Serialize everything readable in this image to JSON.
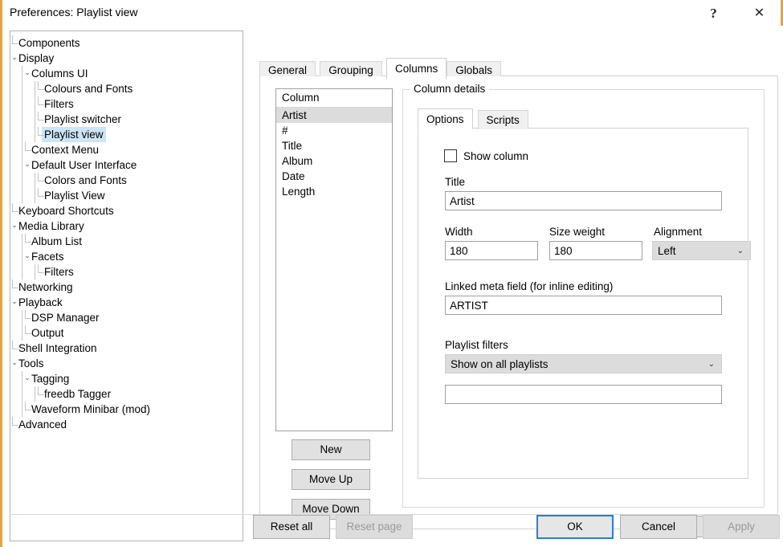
{
  "window": {
    "title": "Preferences: Playlist view",
    "accent_color": "#e8a33d",
    "help_glyph": "?",
    "close_glyph": "✕"
  },
  "tree": {
    "items": [
      {
        "label": "Components",
        "depth": 0,
        "chevron": "",
        "selected": false
      },
      {
        "label": "Display",
        "depth": 0,
        "chevron": "v",
        "selected": false
      },
      {
        "label": "Columns UI",
        "depth": 1,
        "chevron": "v",
        "selected": false
      },
      {
        "label": "Colours and Fonts",
        "depth": 2,
        "chevron": "",
        "selected": false
      },
      {
        "label": "Filters",
        "depth": 2,
        "chevron": "",
        "selected": false
      },
      {
        "label": "Playlist switcher",
        "depth": 2,
        "chevron": "",
        "selected": false
      },
      {
        "label": "Playlist view",
        "depth": 2,
        "chevron": "",
        "selected": true
      },
      {
        "label": "Context Menu",
        "depth": 1,
        "chevron": "",
        "selected": false
      },
      {
        "label": "Default User Interface",
        "depth": 1,
        "chevron": "v",
        "selected": false
      },
      {
        "label": "Colors and Fonts",
        "depth": 2,
        "chevron": "",
        "selected": false
      },
      {
        "label": "Playlist View",
        "depth": 2,
        "chevron": "",
        "selected": false
      },
      {
        "label": "Keyboard Shortcuts",
        "depth": 0,
        "chevron": "",
        "selected": false
      },
      {
        "label": "Media Library",
        "depth": 0,
        "chevron": "v",
        "selected": false
      },
      {
        "label": "Album List",
        "depth": 1,
        "chevron": "",
        "selected": false
      },
      {
        "label": "Facets",
        "depth": 1,
        "chevron": "v",
        "selected": false
      },
      {
        "label": "Filters",
        "depth": 2,
        "chevron": "",
        "selected": false
      },
      {
        "label": "Networking",
        "depth": 0,
        "chevron": "",
        "selected": false
      },
      {
        "label": "Playback",
        "depth": 0,
        "chevron": "v",
        "selected": false
      },
      {
        "label": "DSP Manager",
        "depth": 1,
        "chevron": "",
        "selected": false
      },
      {
        "label": "Output",
        "depth": 1,
        "chevron": "",
        "selected": false
      },
      {
        "label": "Shell Integration",
        "depth": 0,
        "chevron": "",
        "selected": false
      },
      {
        "label": "Tools",
        "depth": 0,
        "chevron": "v",
        "selected": false
      },
      {
        "label": "Tagging",
        "depth": 1,
        "chevron": "v",
        "selected": false
      },
      {
        "label": "freedb Tagger",
        "depth": 2,
        "chevron": "",
        "selected": false
      },
      {
        "label": "Waveform Minibar (mod)",
        "depth": 1,
        "chevron": "",
        "selected": false
      },
      {
        "label": "Advanced",
        "depth": 0,
        "chevron": "",
        "selected": false
      }
    ]
  },
  "tabs": {
    "items": [
      {
        "label": "General",
        "active": false
      },
      {
        "label": "Grouping",
        "active": false
      },
      {
        "label": "Columns",
        "active": true
      },
      {
        "label": "Globals",
        "active": false
      }
    ]
  },
  "column_list": {
    "header": "Column",
    "rows": [
      {
        "label": "Artist",
        "selected": true
      },
      {
        "label": "#",
        "selected": false
      },
      {
        "label": "Title",
        "selected": false
      },
      {
        "label": "Album",
        "selected": false
      },
      {
        "label": "Date",
        "selected": false
      },
      {
        "label": "Length",
        "selected": false
      }
    ]
  },
  "list_buttons": {
    "new": "New",
    "move_up": "Move Up",
    "move_down": "Move Down"
  },
  "details": {
    "group_title": "Column details",
    "inner_tabs": [
      {
        "label": "Options",
        "active": true
      },
      {
        "label": "Scripts",
        "active": false
      }
    ],
    "show_column_label": "Show column",
    "show_column_checked": false,
    "title_label": "Title",
    "title_value": "Artist",
    "width_label": "Width",
    "width_value": "180",
    "size_weight_label": "Size weight",
    "size_weight_value": "180",
    "alignment_label": "Alignment",
    "alignment_value": "Left",
    "alignment_arrow": "⌄",
    "linked_meta_label": "Linked meta field (for inline editing)",
    "linked_meta_value": "ARTIST",
    "playlist_filters_label": "Playlist filters",
    "playlist_filters_value": "Show on all playlists",
    "playlist_filters_arrow": "⌄",
    "filter_extra_value": "",
    "apply_label": "Apply"
  },
  "bottom_bar": {
    "reset_all": "Reset all",
    "reset_page": "Reset page",
    "ok": "OK",
    "cancel": "Cancel",
    "apply": "Apply"
  }
}
